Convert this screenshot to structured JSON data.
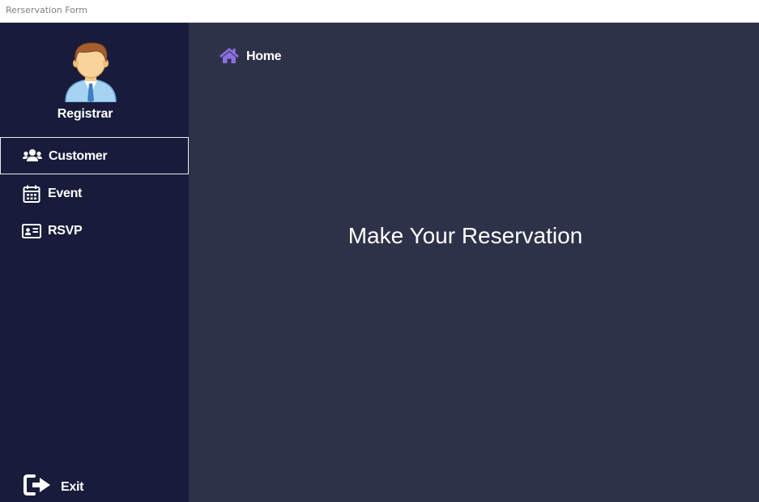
{
  "window": {
    "title": "Rerservation Form"
  },
  "sidebar": {
    "profile": {
      "name": "Registrar",
      "icon": "user-avatar-icon"
    },
    "items": [
      {
        "label": "Customer",
        "icon": "users-icon",
        "active": true
      },
      {
        "label": "Event",
        "icon": "calendar-icon",
        "active": false
      },
      {
        "label": "RSVP",
        "icon": "id-card-icon",
        "active": false
      }
    ],
    "exit": {
      "label": "Exit",
      "icon": "sign-out-icon"
    }
  },
  "main": {
    "breadcrumb": {
      "label": "Home",
      "icon": "home-icon"
    },
    "headline": "Make Your Reservation"
  },
  "colors": {
    "sidebar_bg": "#181c3a",
    "main_bg": "#2e3249",
    "accent": "#8a6fe0",
    "text": "#ffffff"
  }
}
